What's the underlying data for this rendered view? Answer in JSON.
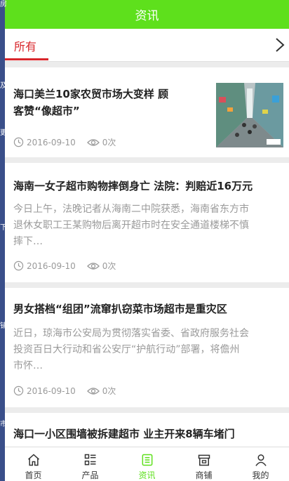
{
  "left_strip": {
    "chars": [
      "房",
      "及",
      "更",
      "下",
      "铺",
      "市"
    ]
  },
  "header": {
    "title": "资讯"
  },
  "category": {
    "selected": "所有"
  },
  "articles": [
    {
      "title_line1": "海口美兰10家农贸市场大变样 顾",
      "title_line2": "客赞“像超市”",
      "date": "2016-09-10",
      "views": "0次"
    },
    {
      "title": "海南一女子超市购物摔倒身亡 法院：判赔近16万元",
      "desc_line1": "今日上午，法晚记者从海南二中院获悉，海南省东方市",
      "desc_line2": "退休女职工王某购物后离开超市时在安全通道楼梯不慎",
      "desc_line3": "摔下…",
      "date": "2016-09-10",
      "views": "0次"
    },
    {
      "title": "男女搭档“组团”流窜扒窃菜市场超市是重灾区",
      "desc_line1": "近日，琼海市公安局为贯彻落实省委、省政府服务社会",
      "desc_line2": "投资百日大行动和省公安厅“护航行动”部署，将儋州",
      "desc_line3": "市怀…",
      "date": "2016-09-10",
      "views": "0次"
    },
    {
      "title": "海口一小区围墙被拆建超市 业主开来8辆车堵门"
    }
  ],
  "tabbar": {
    "items": [
      {
        "label": "首页",
        "icon": "home-icon"
      },
      {
        "label": "产品",
        "icon": "grid-list-icon"
      },
      {
        "label": "资讯",
        "icon": "news-icon"
      },
      {
        "label": "商铺",
        "icon": "store-icon"
      },
      {
        "label": "我的",
        "icon": "user-icon"
      }
    ],
    "active_index": 2
  },
  "colors": {
    "accent": "#5ee01c",
    "category": "#d8262b"
  }
}
